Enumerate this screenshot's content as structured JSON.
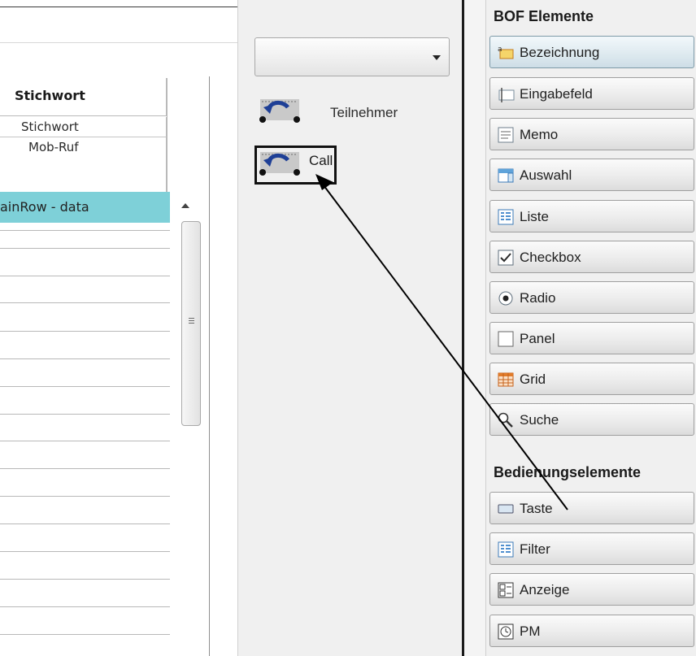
{
  "table": {
    "header": "Stichwort",
    "sub_rows": [
      "Stichwort",
      "Mob-Ruf"
    ],
    "selected_row": "ainRow - data"
  },
  "canvas": {
    "widgets": [
      {
        "label": "Teilnehmer",
        "icon": "call-widget-icon"
      },
      {
        "label": "Call",
        "icon": "call-widget-icon",
        "selected": true
      }
    ]
  },
  "toolbox": {
    "sections": [
      {
        "title": "BOF Elemente",
        "items": [
          {
            "label": "Bezeichnung",
            "icon": "label-icon"
          },
          {
            "label": "Eingabefeld",
            "icon": "textfield-icon"
          },
          {
            "label": "Memo",
            "icon": "memo-icon"
          },
          {
            "label": "Auswahl",
            "icon": "combobox-icon"
          },
          {
            "label": "Liste",
            "icon": "list-icon"
          },
          {
            "label": "Checkbox",
            "icon": "checkbox-icon"
          },
          {
            "label": "Radio",
            "icon": "radio-icon"
          },
          {
            "label": "Panel",
            "icon": "panel-icon"
          },
          {
            "label": "Grid",
            "icon": "grid-icon"
          },
          {
            "label": "Suche",
            "icon": "search-icon"
          }
        ]
      },
      {
        "title": "Bedienungselemente",
        "items": [
          {
            "label": "Taste",
            "icon": "button-icon"
          },
          {
            "label": "Filter",
            "icon": "filter-icon"
          },
          {
            "label": "Anzeige",
            "icon": "display-icon"
          },
          {
            "label": "PM",
            "icon": "clock-icon"
          }
        ]
      }
    ]
  },
  "colors": {
    "selected_row": "#7ed0d8",
    "accent_selected_button": "#dde9ef"
  }
}
